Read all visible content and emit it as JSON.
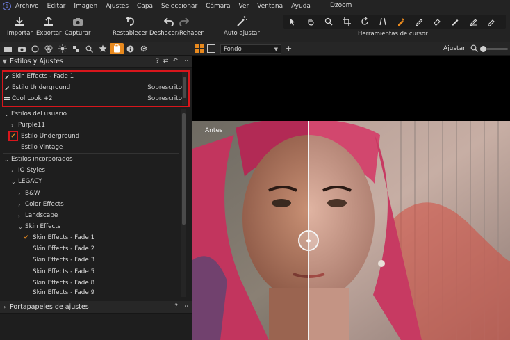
{
  "menubar": {
    "items": [
      "Archivo",
      "Editar",
      "Imagen",
      "Ajustes",
      "Capa",
      "Seleccionar",
      "Cámara",
      "Ver",
      "Ventana",
      "Ayuda"
    ],
    "window_title": "Dzoom"
  },
  "toolbar": {
    "import_label": "Importar",
    "export_label": "Exportar",
    "capture_label": "Capturar",
    "reset_label": "Restablecer",
    "undo_redo_label": "Deshacer/Rehacer",
    "auto_adjust_label": "Auto ajustar",
    "cursor_tools_label": "Herramientas de cursor",
    "cursor_tools": [
      "select-icon",
      "pan-icon",
      "loupe-icon",
      "crop-icon",
      "rotate-icon",
      "keystone-icon",
      "picker-icon",
      "brush-icon",
      "eraser-icon",
      "draw-mask-icon",
      "gradient-icon",
      "annotate-icon"
    ]
  },
  "tooltabs": {
    "icons": [
      "folder-icon",
      "camera-icon",
      "circle-icon",
      "color-icon",
      "exposure-icon",
      "detail-icon",
      "search-icon",
      "star-icon",
      "styles-icon",
      "info-icon",
      "gear-icon"
    ],
    "active_index": 8
  },
  "viewerbar": {
    "background_select": "Fondo",
    "fit_label": "Ajustar",
    "zoom_level": 0.0
  },
  "styles_panel": {
    "title": "Estilos y Ajustes",
    "applied": [
      {
        "icon": "brush-icon",
        "name": "Skin Effects - Fade 1",
        "status": ""
      },
      {
        "icon": "brush-icon",
        "name": "Estilo Underground",
        "status": "Sobrescrito"
      },
      {
        "icon": "stack-icon",
        "name": "Cool Look +2",
        "status": "Sobrescrito"
      }
    ],
    "user_styles_title": "Estilos del usuario",
    "user_styles": [
      {
        "name": "Purple11",
        "chevron": true,
        "checked": false
      },
      {
        "name": "Estilo Underground",
        "chevron": false,
        "checked": true
      },
      {
        "name": "Estilo Vintage",
        "chevron": false,
        "checked": false
      }
    ],
    "builtin_title": "Estilos incorporados",
    "builtin": [
      {
        "name": "IQ Styles",
        "level": 1,
        "chevron": "right",
        "checked": false
      },
      {
        "name": "LEGACY",
        "level": 1,
        "chevron": "down",
        "checked": false
      },
      {
        "name": "B&W",
        "level": 2,
        "chevron": "right",
        "checked": false
      },
      {
        "name": "Color Effects",
        "level": 2,
        "chevron": "right",
        "checked": false
      },
      {
        "name": "Landscape",
        "level": 2,
        "chevron": "right",
        "checked": false
      },
      {
        "name": "Skin Effects",
        "level": 2,
        "chevron": "down",
        "checked": false
      },
      {
        "name": "Skin Effects - Fade 1",
        "level": 3,
        "chevron": "",
        "checked": true
      },
      {
        "name": "Skin Effects - Fade 2",
        "level": 3,
        "chevron": "",
        "checked": false
      },
      {
        "name": "Skin Effects - Fade 3",
        "level": 3,
        "chevron": "",
        "checked": false
      },
      {
        "name": "Skin Effects - Fade 5",
        "level": 3,
        "chevron": "",
        "checked": false
      },
      {
        "name": "Skin Effects - Fade 8",
        "level": 3,
        "chevron": "",
        "checked": false
      },
      {
        "name": "Skin Effects - Fade 9",
        "level": 3,
        "chevron": "",
        "checked": false
      }
    ]
  },
  "clipboard_panel": {
    "title": "Portapapeles de ajustes"
  },
  "viewer": {
    "before_label": "Antes"
  },
  "colors": {
    "accent": "#e8891e",
    "highlight_box": "#d8161c"
  }
}
